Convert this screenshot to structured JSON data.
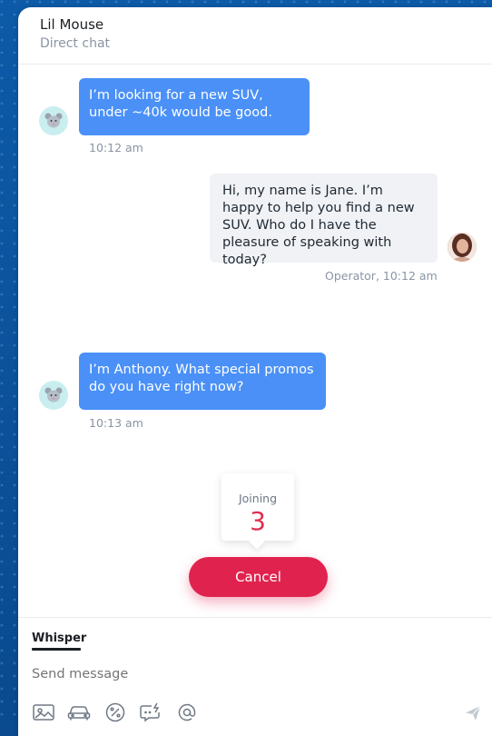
{
  "header": {
    "name": "Lil Mouse",
    "subtitle": "Direct chat"
  },
  "messages": [
    {
      "sender": "customer",
      "text": "I’m looking for a new SUV, under ~40k would be good.",
      "time": "10:12 am"
    },
    {
      "sender": "operator",
      "text": "Hi, my name is Jane. I’m happy to help you find a new SUV. Who do I have the pleasure of speaking with today?",
      "time": "Operator, 10:12 am"
    },
    {
      "sender": "customer",
      "text": "I’m Anthony. What special promos do you have right now?",
      "time": "10:13 am"
    }
  ],
  "joining": {
    "label": "Joining",
    "count": "3"
  },
  "cancel_label": "Cancel",
  "composer": {
    "tab_label": "Whisper",
    "placeholder": "Send message",
    "tools": [
      "image-icon",
      "car-icon",
      "percent-icon",
      "quick-reply-icon",
      "at-icon"
    ],
    "send_icon": "send-icon"
  },
  "colors": {
    "accent": "#4a90f7",
    "cancel": "#e0234e",
    "count": "#e02f52",
    "background": "#0b4a8e"
  }
}
